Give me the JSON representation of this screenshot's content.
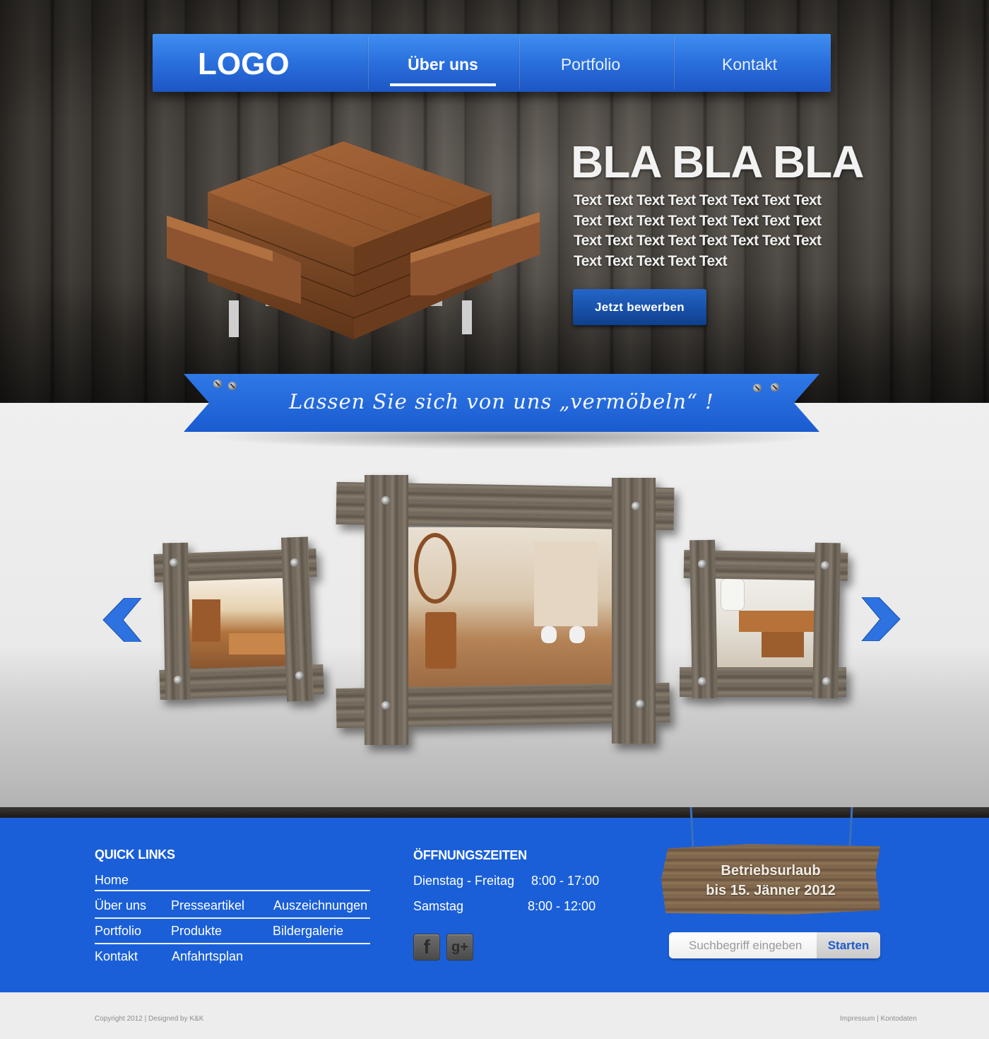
{
  "header": {
    "logo": "LOGO",
    "nav": [
      {
        "label": "Über uns",
        "active": true
      },
      {
        "label": "Portfolio",
        "active": false
      },
      {
        "label": "Kontakt",
        "active": false
      }
    ]
  },
  "hero": {
    "title": "BLA BLA BLA",
    "text": "Text Text Text Text Text Text Text Text Text Text Text Text Text Text Text Text Text Text Text Text Text Text Text Text Text Text Text Text Text",
    "button_label": "Jetzt bewerben"
  },
  "ribbon": {
    "text": "Lassen Sie sich von uns „vermöbeln“ !"
  },
  "gallery": {
    "prev_icon": "chevron-left-icon",
    "next_icon": "chevron-right-icon",
    "photos": [
      "kitchen-photo",
      "bathroom-photo",
      "office-photo"
    ]
  },
  "footer": {
    "quick_links_title": "QUICK LINKS",
    "links": {
      "home": "Home",
      "ueber_uns": "Über uns",
      "presseartikel": "Presseartikel",
      "auszeichnungen": "Auszeichnungen",
      "portfolio": "Portfolio",
      "produkte": "Produkte",
      "bildergalerie": "Bildergalerie",
      "kontakt": "Kontakt",
      "anfahrtsplan": "Anfahrtsplan"
    },
    "hours_title": "ÖFFNUNGSZEITEN",
    "hours": [
      {
        "days": "Dienstag - Freitag",
        "time": "8:00 - 17:00"
      },
      {
        "days": "Samstag",
        "time": "8:00 - 12:00"
      }
    ],
    "social": [
      {
        "icon": "facebook-icon",
        "glyph": "f"
      },
      {
        "icon": "google-plus-icon",
        "glyph": "g+"
      }
    ],
    "sign": {
      "line1": "Betriebsurlaub",
      "line2": "bis 15. Jänner 2012"
    },
    "search": {
      "placeholder": "Suchbegriff eingeben",
      "button_label": "Starten"
    }
  },
  "bottom": {
    "copyright": "Copyright 2012",
    "designed_by": "Designed by K&K",
    "impressum": "Impressum",
    "kontodaten": "Kontodaten",
    "separator": "|"
  },
  "colors": {
    "brand_blue": "#1a5fd8",
    "nav_blue": "#2a6fdd",
    "button_blue": "#1a4fa8"
  }
}
